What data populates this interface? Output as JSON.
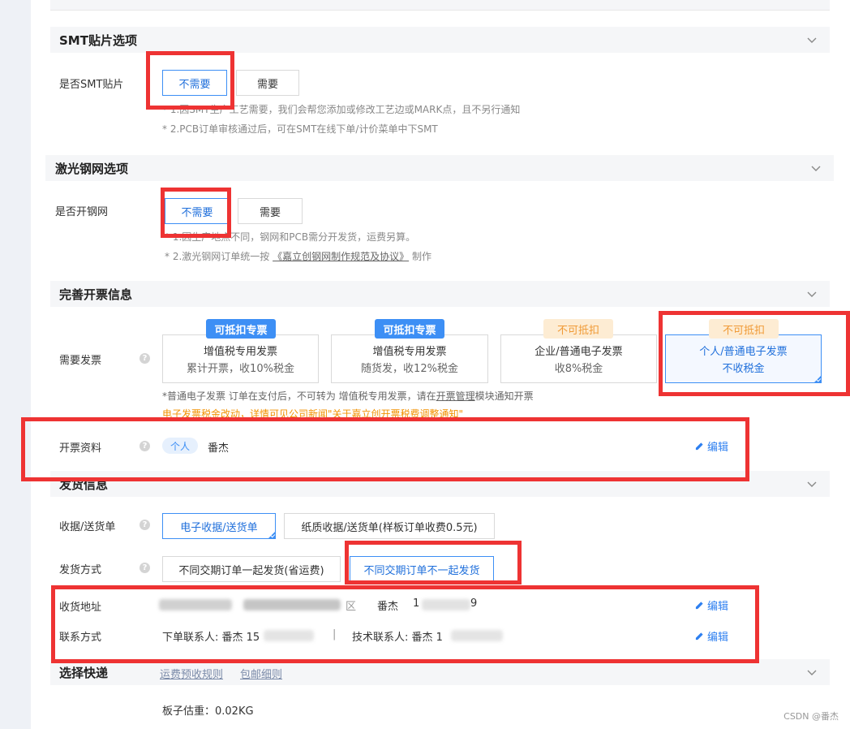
{
  "smt": {
    "title": "SMT贴片选项",
    "label": "是否SMT贴片",
    "options": [
      "不需要",
      "需要"
    ],
    "notes": [
      "* 1.因SMT生产工艺需要，我们会帮您添加或修改工艺边或MARK点，且不另行通知",
      "* 2.PCB订单审核通过后，可在SMT在线下单/计价菜单中下SMT"
    ]
  },
  "stencil": {
    "title": "激光钢网选项",
    "label": "是否开钢网",
    "options": [
      "不需要",
      "需要"
    ],
    "note1": "* 1.因生产地点不同，钢网和PCB需分开发货，运费另算。",
    "note2_prefix": "* 2.激光钢网订单统一按",
    "note2_link": "《嘉立创钢网制作规范及协议》",
    "note2_suffix": "制作"
  },
  "invoice": {
    "title": "完善开票信息",
    "label": "需要发票",
    "help_icon": "?",
    "cards": [
      {
        "badge": "可抵扣专票",
        "line1": "增值税专用发票",
        "line2": "累计开票，收10%税金"
      },
      {
        "badge": "可抵扣专票",
        "line1": "增值税专用发票",
        "line2": "随货发，收12%税金"
      },
      {
        "badge": "不可抵扣",
        "line1": "企业/普通电子发票",
        "line2": "收8%税金"
      },
      {
        "badge": "不可抵扣",
        "line1": "个人/普通电子发票",
        "line2": "不收税金"
      }
    ],
    "note_prefix": "*普通电子发票 订单在支付后，不可转为 增值税专用发票，请在",
    "note_link": "开票管理",
    "note_suffix": "模块通知开票",
    "warning": "电子发票税金改动，详情可见公司新闻\"关于嘉立创开票税费调整通知\"",
    "profile_label": "开票资料",
    "profile_tag": "个人",
    "profile_name": "番杰",
    "edit": "编辑"
  },
  "shipping": {
    "title": "发货信息",
    "receipt_label": "收据/送货单",
    "receipt_options": [
      "电子收据/送货单",
      "纸质收据/送货单(样板订单收费0.5元)"
    ],
    "method_label": "发货方式",
    "method_options": [
      "不同交期订单一起发货(省运费)",
      "不同交期订单不一起发货"
    ],
    "address_label": "收货地址",
    "address_name": "番杰",
    "address_tail": "9",
    "address_partial": "区",
    "contact_label": "联系方式",
    "order_contact": "下单联系人: 番杰 15",
    "divider": "|",
    "tech_contact": "技术联系人: 番杰 1",
    "edit": "编辑"
  },
  "express": {
    "title": "选择快递",
    "link1": "运费预收规则",
    "link2": "包邮细则",
    "weight": "板子估重：0.02KG"
  },
  "watermark": "CSDN @番杰",
  "colors": {
    "accent": "#3d8ff5",
    "annotation_red": "#ee3333",
    "warning_orange": "#f29100"
  }
}
